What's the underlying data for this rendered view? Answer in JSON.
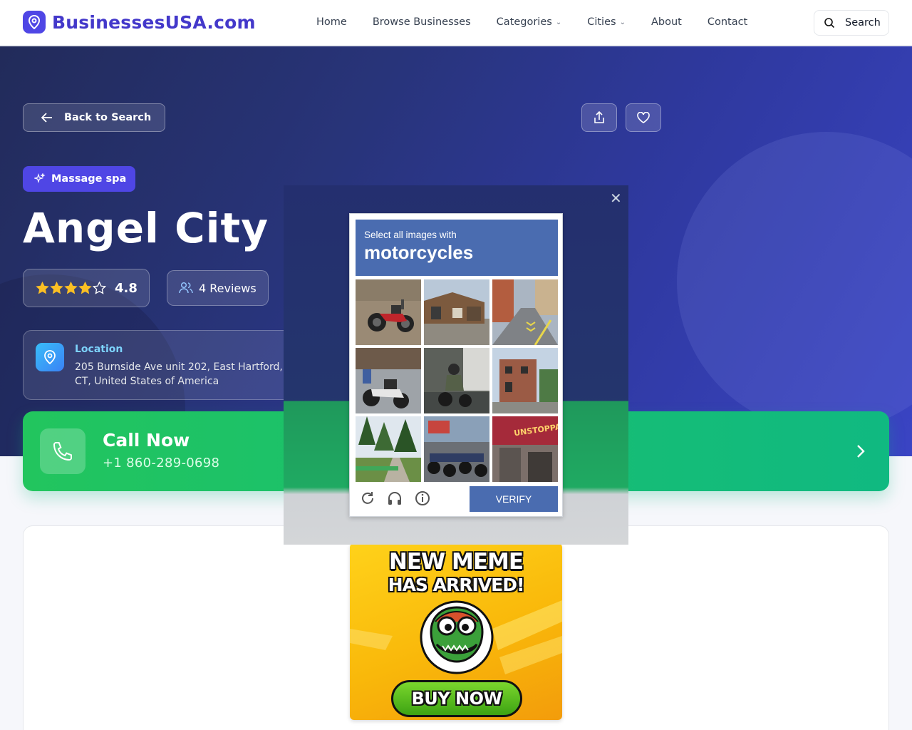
{
  "brand": {
    "name": "BusinessesUSA.com",
    "icon": "map-pin-icon",
    "color": "#4338ca"
  },
  "nav": {
    "links": [
      {
        "label": "Home"
      },
      {
        "label": "Browse Businesses"
      },
      {
        "label": "Categories",
        "dropdown": true
      },
      {
        "label": "Cities",
        "dropdown": true
      },
      {
        "label": "About"
      },
      {
        "label": "Contact"
      }
    ],
    "search_label": "Search"
  },
  "hero": {
    "back_label": "Back to Search",
    "share_icon": "share-icon",
    "favorite_icon": "heart-icon",
    "category": "Massage spa",
    "title": "Angel City Spa",
    "rating": "4.8",
    "rating_stars": 4,
    "reviews": "4 Reviews",
    "location_label": "Location",
    "address": "205 Burnside Ave unit 202, East Hartford, CT, United States of America"
  },
  "call": {
    "title": "Call Now",
    "number": "+1 860-289-0698",
    "accent": "#22c55e"
  },
  "captcha": {
    "instruction": "Select all images with",
    "target": "motorcycles",
    "verify_label": "VERIFY",
    "header_color": "#4a6cb0",
    "tiles": [
      {
        "scene": "dirt-road-motorcycle"
      },
      {
        "scene": "street-house"
      },
      {
        "scene": "road-sidewalk"
      },
      {
        "scene": "parked-motorcycles"
      },
      {
        "scene": "rider-on-motorcycle"
      },
      {
        "scene": "brick-building"
      },
      {
        "scene": "trees-path"
      },
      {
        "scene": "motorcycle-row"
      },
      {
        "scene": "shop-sign"
      }
    ],
    "tile_sign_text": "UNSTOPPA"
  },
  "ad": {
    "line1": "NEW MEME",
    "line2": "HAS ARRIVED!",
    "button": "BUY NOW"
  }
}
